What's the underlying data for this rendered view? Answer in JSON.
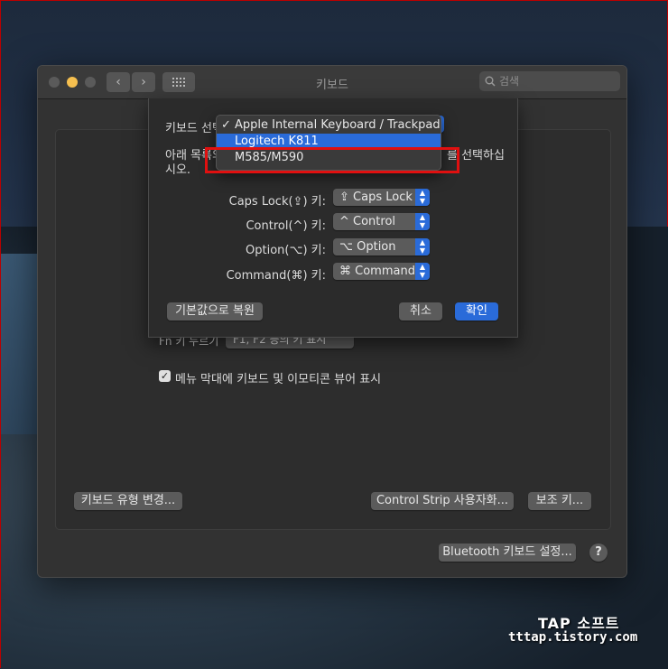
{
  "window": {
    "title": "키보드",
    "search_placeholder": "검색"
  },
  "main": {
    "fn_row_label": "Fn 키 누르기",
    "fn_row_value": "F1, F2 등의 키 표시",
    "menu_bar_checkbox": "메뉴 막대에 키보드 및 이모티콘 뷰어 표시",
    "menu_bar_checked": true,
    "change_type_button": "키보드 유형 변경...",
    "control_strip_button": "Control Strip 사용자화...",
    "modifier_button": "보조 키...",
    "bluetooth_button": "Bluetooth 키보드 설정...",
    "help_button": "?"
  },
  "sheet": {
    "select_label": "키보드 선택",
    "instruction_line1": "아래 목록의",
    "instruction_line1_end": "를 선택하십",
    "instruction_line2": "시오.",
    "rows": [
      {
        "label": "Caps Lock(⇪) 키:",
        "value": "⇪ Caps Lock"
      },
      {
        "label": "Control(^) 키:",
        "value": "^ Control"
      },
      {
        "label": "Option(⌥) 키:",
        "value": "⌥ Option"
      },
      {
        "label": "Command(⌘) 키:",
        "value": "⌘ Command"
      }
    ],
    "restore_button": "기본값으로 복원",
    "cancel_button": "취소",
    "ok_button": "확인"
  },
  "dropdown": {
    "items": [
      {
        "label": "Apple Internal Keyboard / Trackpad",
        "checked": true
      },
      {
        "label": "Logitech K811",
        "selected": true
      },
      {
        "label": "M585/M590"
      }
    ],
    "check_mark": "✓"
  },
  "watermark": {
    "title": "TAP 소프트",
    "url": "tttap.tistory.com"
  },
  "colors": {
    "accent": "#2a6bd9",
    "highlight_box": "#e01010",
    "close": "#ed6a5e",
    "minimize": "#f5bf4f",
    "zoom": "#62c554"
  }
}
